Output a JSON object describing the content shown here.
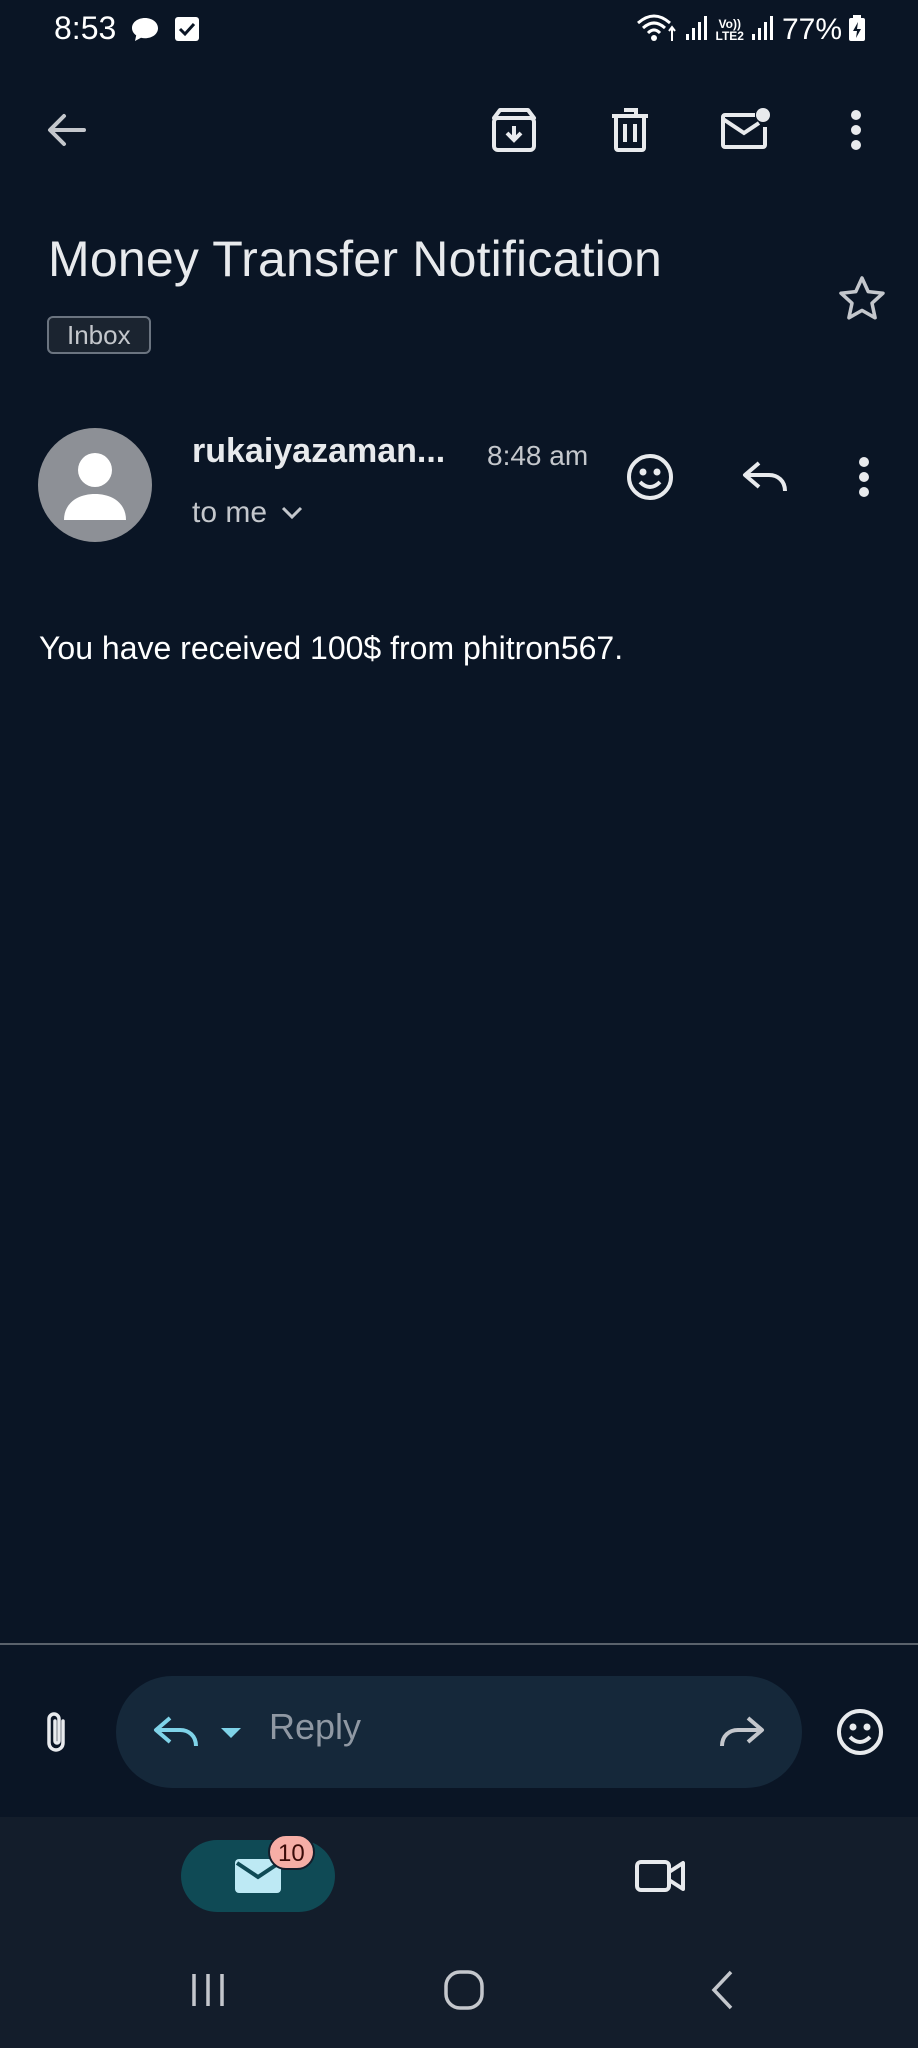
{
  "status_bar": {
    "time": "8:53",
    "battery": "77%",
    "network_line1": "Vo))",
    "network_line2": "LTE2"
  },
  "toolbar": {
    "icons": [
      "back-arrow-icon",
      "archive-icon",
      "delete-icon",
      "mark-unread-icon",
      "more-vert-icon"
    ]
  },
  "email": {
    "subject": "Money Transfer Notification",
    "label": "Inbox",
    "sender": "rukaiyazaman...",
    "time": "8:48 am",
    "recipient": "to me",
    "body": "You have received 100$ from phitron567."
  },
  "reply_bar": {
    "placeholder": "Reply"
  },
  "bottom_nav": {
    "mail_badge": "10"
  },
  "colors": {
    "background": "#0a1525",
    "reply_pill": "#15283a",
    "accent_cyan": "#7fd3e8",
    "mail_tab": "#0f4a55",
    "badge": "#f6aea6"
  }
}
